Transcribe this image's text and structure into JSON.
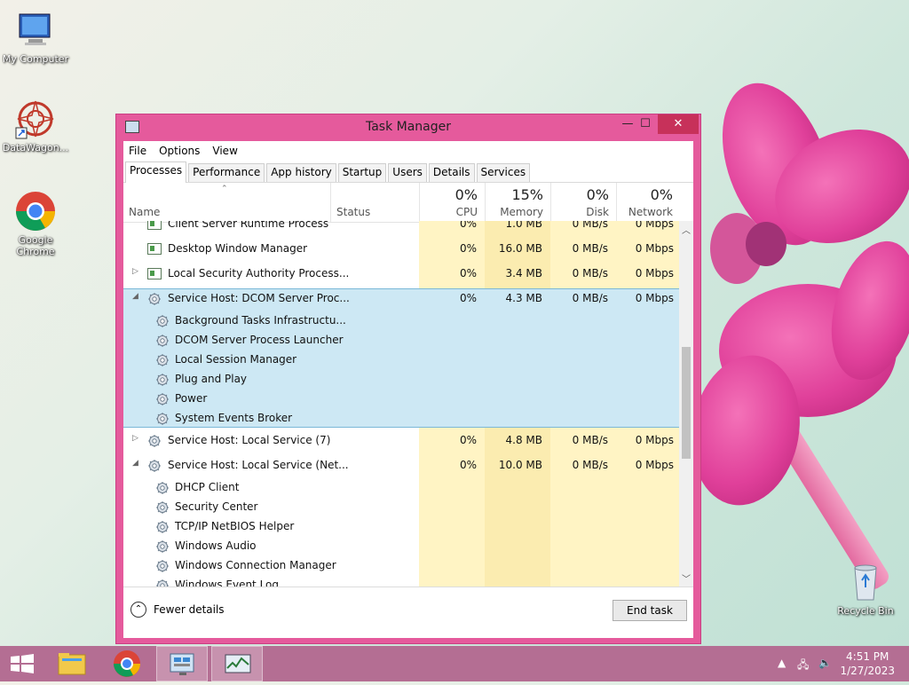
{
  "desktop": {
    "icons": [
      {
        "label": "My Computer"
      },
      {
        "label": "DataWagon..."
      },
      {
        "label": "Google Chrome"
      },
      {
        "label": "Recycle Bin"
      }
    ]
  },
  "window": {
    "title": "Task Manager",
    "controls": {
      "minimize": "—",
      "maximize": "☐",
      "close": "✕"
    },
    "menu": [
      "File",
      "Options",
      "View"
    ],
    "tabs": [
      "Processes",
      "Performance",
      "App history",
      "Startup",
      "Users",
      "Details",
      "Services"
    ],
    "active_tab": "Processes",
    "columns": {
      "name": "Name",
      "status": "Status",
      "cpu": {
        "label": "CPU",
        "pct": "0%"
      },
      "memory": {
        "label": "Memory",
        "pct": "15%"
      },
      "disk": {
        "label": "Disk",
        "pct": "0%"
      },
      "network": {
        "label": "Network",
        "pct": "0%"
      }
    },
    "rows": [
      {
        "name": "Client Server Runtime Process",
        "cpu": "0%",
        "mem": "1.0 MB",
        "disk": "0 MB/s",
        "net": "0 Mbps",
        "type": "proc"
      },
      {
        "name": "Desktop Window Manager",
        "cpu": "0%",
        "mem": "16.0 MB",
        "disk": "0 MB/s",
        "net": "0 Mbps",
        "type": "proc"
      },
      {
        "name": "Local Security Authority Process...",
        "cpu": "0%",
        "mem": "3.4 MB",
        "disk": "0 MB/s",
        "net": "0 Mbps",
        "type": "proc",
        "expander": "▷"
      },
      {
        "name": "Service Host: DCOM Server Proc...",
        "cpu": "0%",
        "mem": "4.3 MB",
        "disk": "0 MB/s",
        "net": "0 Mbps",
        "type": "svc",
        "expander": "◢"
      },
      {
        "name": "Background Tasks Infrastructu...",
        "type": "child"
      },
      {
        "name": "DCOM Server Process Launcher",
        "type": "child"
      },
      {
        "name": "Local Session Manager",
        "type": "child"
      },
      {
        "name": "Plug and Play",
        "type": "child"
      },
      {
        "name": "Power",
        "type": "child"
      },
      {
        "name": "System Events Broker",
        "type": "child"
      },
      {
        "name": "Service Host: Local Service (7)",
        "cpu": "0%",
        "mem": "4.8 MB",
        "disk": "0 MB/s",
        "net": "0 Mbps",
        "type": "svc",
        "expander": "▷"
      },
      {
        "name": "Service Host: Local Service (Net...",
        "cpu": "0%",
        "mem": "10.0 MB",
        "disk": "0 MB/s",
        "net": "0 Mbps",
        "type": "svc",
        "expander": "◢"
      },
      {
        "name": "DHCP Client",
        "type": "child"
      },
      {
        "name": "Security Center",
        "type": "child"
      },
      {
        "name": "TCP/IP NetBIOS Helper",
        "type": "child"
      },
      {
        "name": "Windows Audio",
        "type": "child"
      },
      {
        "name": "Windows Connection Manager",
        "type": "child"
      },
      {
        "name": "Windows Event Log",
        "type": "child"
      }
    ],
    "footer": {
      "fewer_details": "Fewer details",
      "end_task": "End task"
    }
  },
  "taskbar": {
    "items": [
      "start",
      "file-explorer",
      "chrome",
      "control-panel",
      "task-manager"
    ],
    "clock": {
      "time": "4:51 PM",
      "date": "1/27/2023"
    }
  },
  "colors": {
    "window_frame": "#e55a9c",
    "selection": "#cce8f5",
    "heat": "#fff4c4",
    "heat_mem": "#fbecb0"
  }
}
